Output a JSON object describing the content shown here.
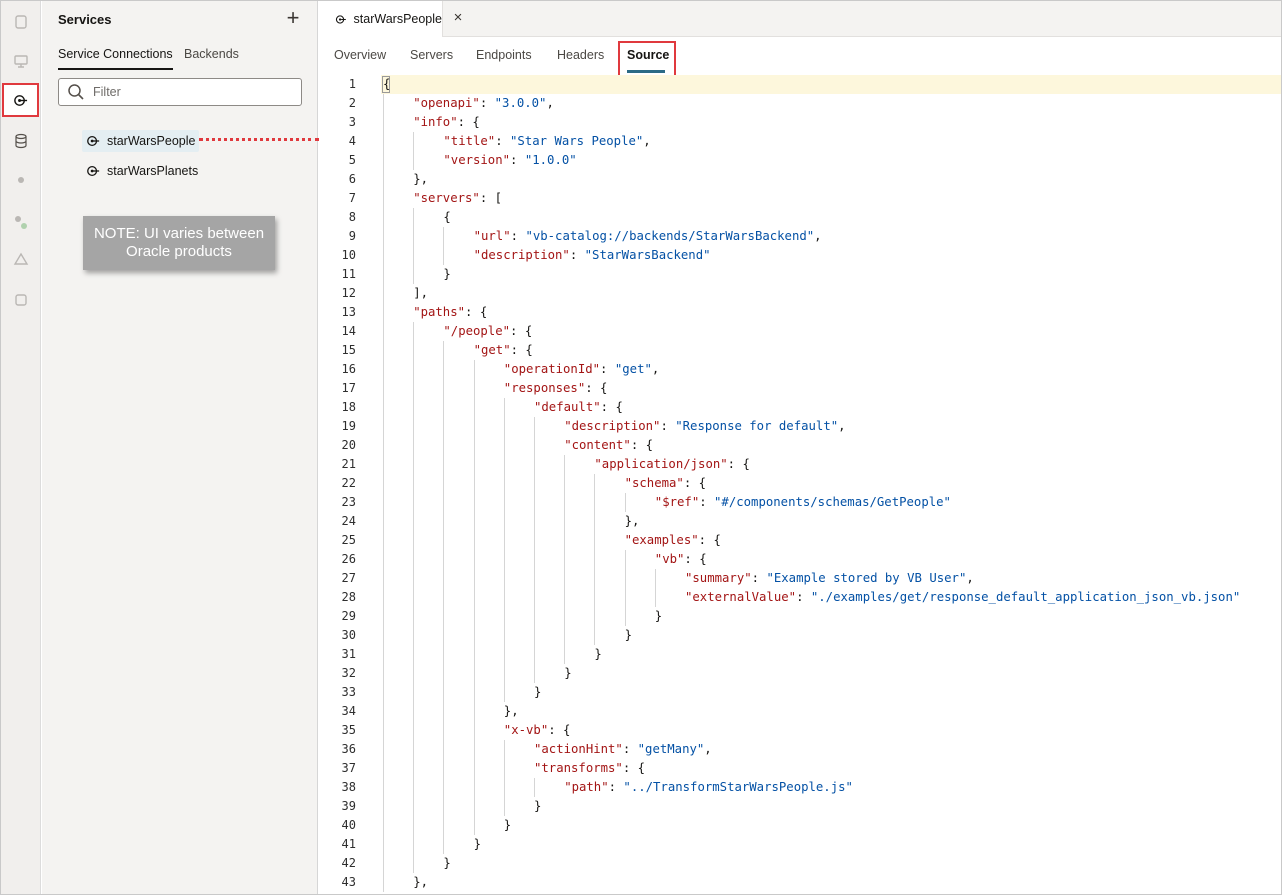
{
  "panel": {
    "title": "Services",
    "add_label": "+",
    "tabs": [
      "Service Connections",
      "Backends"
    ],
    "filter_placeholder": "Filter",
    "items": [
      "starWarsPeople",
      "starWarsPlanets"
    ]
  },
  "note": "NOTE: UI varies between Oracle products",
  "editor": {
    "tab_title": "starWarsPeople",
    "close_label": "×",
    "subtabs": [
      "Overview",
      "Servers",
      "Endpoints",
      "Headers",
      "Source"
    ],
    "active_subtab": "Source"
  },
  "colors": {
    "highlight": "#e0393e",
    "json_key": "#a31515",
    "json_string": "#0451a5",
    "active_underline": "#2b6a86"
  },
  "code_lines": [
    {
      "n": 1,
      "i": 0,
      "t": [
        [
          "p",
          "{"
        ]
      ]
    },
    {
      "n": 2,
      "i": 1,
      "t": [
        [
          "k",
          "\"openapi\""
        ],
        [
          "p",
          ": "
        ],
        [
          "s",
          "\"3.0.0\""
        ],
        [
          "p",
          ","
        ]
      ]
    },
    {
      "n": 3,
      "i": 1,
      "t": [
        [
          "k",
          "\"info\""
        ],
        [
          "p",
          ": {"
        ]
      ]
    },
    {
      "n": 4,
      "i": 2,
      "t": [
        [
          "k",
          "\"title\""
        ],
        [
          "p",
          ": "
        ],
        [
          "s",
          "\"Star Wars People\""
        ],
        [
          "p",
          ","
        ]
      ]
    },
    {
      "n": 5,
      "i": 2,
      "t": [
        [
          "k",
          "\"version\""
        ],
        [
          "p",
          ": "
        ],
        [
          "s",
          "\"1.0.0\""
        ]
      ]
    },
    {
      "n": 6,
      "i": 1,
      "t": [
        [
          "p",
          "},"
        ]
      ]
    },
    {
      "n": 7,
      "i": 1,
      "t": [
        [
          "k",
          "\"servers\""
        ],
        [
          "p",
          ": ["
        ]
      ]
    },
    {
      "n": 8,
      "i": 2,
      "t": [
        [
          "p",
          "{"
        ]
      ]
    },
    {
      "n": 9,
      "i": 3,
      "t": [
        [
          "k",
          "\"url\""
        ],
        [
          "p",
          ": "
        ],
        [
          "s",
          "\"vb-catalog://backends/StarWarsBackend\""
        ],
        [
          "p",
          ","
        ]
      ]
    },
    {
      "n": 10,
      "i": 3,
      "t": [
        [
          "k",
          "\"description\""
        ],
        [
          "p",
          ": "
        ],
        [
          "s",
          "\"StarWarsBackend\""
        ]
      ]
    },
    {
      "n": 11,
      "i": 2,
      "t": [
        [
          "p",
          "}"
        ]
      ]
    },
    {
      "n": 12,
      "i": 1,
      "t": [
        [
          "p",
          "],"
        ]
      ]
    },
    {
      "n": 13,
      "i": 1,
      "t": [
        [
          "k",
          "\"paths\""
        ],
        [
          "p",
          ": {"
        ]
      ]
    },
    {
      "n": 14,
      "i": 2,
      "t": [
        [
          "k",
          "\"/people\""
        ],
        [
          "p",
          ": {"
        ]
      ]
    },
    {
      "n": 15,
      "i": 3,
      "t": [
        [
          "k",
          "\"get\""
        ],
        [
          "p",
          ": {"
        ]
      ]
    },
    {
      "n": 16,
      "i": 4,
      "t": [
        [
          "k",
          "\"operationId\""
        ],
        [
          "p",
          ": "
        ],
        [
          "s",
          "\"get\""
        ],
        [
          "p",
          ","
        ]
      ]
    },
    {
      "n": 17,
      "i": 4,
      "t": [
        [
          "k",
          "\"responses\""
        ],
        [
          "p",
          ": {"
        ]
      ]
    },
    {
      "n": 18,
      "i": 5,
      "t": [
        [
          "k",
          "\"default\""
        ],
        [
          "p",
          ": {"
        ]
      ]
    },
    {
      "n": 19,
      "i": 6,
      "t": [
        [
          "k",
          "\"description\""
        ],
        [
          "p",
          ": "
        ],
        [
          "s",
          "\"Response for default\""
        ],
        [
          "p",
          ","
        ]
      ]
    },
    {
      "n": 20,
      "i": 6,
      "t": [
        [
          "k",
          "\"content\""
        ],
        [
          "p",
          ": {"
        ]
      ]
    },
    {
      "n": 21,
      "i": 7,
      "t": [
        [
          "k",
          "\"application/json\""
        ],
        [
          "p",
          ": {"
        ]
      ]
    },
    {
      "n": 22,
      "i": 8,
      "t": [
        [
          "k",
          "\"schema\""
        ],
        [
          "p",
          ": {"
        ]
      ]
    },
    {
      "n": 23,
      "i": 9,
      "t": [
        [
          "k",
          "\"$ref\""
        ],
        [
          "p",
          ": "
        ],
        [
          "s",
          "\"#/components/schemas/GetPeople\""
        ]
      ]
    },
    {
      "n": 24,
      "i": 8,
      "t": [
        [
          "p",
          "},"
        ]
      ]
    },
    {
      "n": 25,
      "i": 8,
      "t": [
        [
          "k",
          "\"examples\""
        ],
        [
          "p",
          ": {"
        ]
      ]
    },
    {
      "n": 26,
      "i": 9,
      "t": [
        [
          "k",
          "\"vb\""
        ],
        [
          "p",
          ": {"
        ]
      ]
    },
    {
      "n": 27,
      "i": 10,
      "t": [
        [
          "k",
          "\"summary\""
        ],
        [
          "p",
          ": "
        ],
        [
          "s",
          "\"Example stored by VB User\""
        ],
        [
          "p",
          ","
        ]
      ]
    },
    {
      "n": 28,
      "i": 10,
      "t": [
        [
          "k",
          "\"externalValue\""
        ],
        [
          "p",
          ": "
        ],
        [
          "s",
          "\"./examples/get/response_default_application_json_vb.json\""
        ]
      ]
    },
    {
      "n": 29,
      "i": 9,
      "t": [
        [
          "p",
          "}"
        ]
      ]
    },
    {
      "n": 30,
      "i": 8,
      "t": [
        [
          "p",
          "}"
        ]
      ]
    },
    {
      "n": 31,
      "i": 7,
      "t": [
        [
          "p",
          "}"
        ]
      ]
    },
    {
      "n": 32,
      "i": 6,
      "t": [
        [
          "p",
          "}"
        ]
      ]
    },
    {
      "n": 33,
      "i": 5,
      "t": [
        [
          "p",
          "}"
        ]
      ]
    },
    {
      "n": 34,
      "i": 4,
      "t": [
        [
          "p",
          "},"
        ]
      ]
    },
    {
      "n": 35,
      "i": 4,
      "t": [
        [
          "k",
          "\"x-vb\""
        ],
        [
          "p",
          ": {"
        ]
      ]
    },
    {
      "n": 36,
      "i": 5,
      "t": [
        [
          "k",
          "\"actionHint\""
        ],
        [
          "p",
          ": "
        ],
        [
          "s",
          "\"getMany\""
        ],
        [
          "p",
          ","
        ]
      ]
    },
    {
      "n": 37,
      "i": 5,
      "t": [
        [
          "k",
          "\"transforms\""
        ],
        [
          "p",
          ": {"
        ]
      ]
    },
    {
      "n": 38,
      "i": 6,
      "t": [
        [
          "k",
          "\"path\""
        ],
        [
          "p",
          ": "
        ],
        [
          "s",
          "\"../TransformStarWarsPeople.js\""
        ]
      ]
    },
    {
      "n": 39,
      "i": 5,
      "t": [
        [
          "p",
          "}"
        ]
      ]
    },
    {
      "n": 40,
      "i": 4,
      "t": [
        [
          "p",
          "}"
        ]
      ]
    },
    {
      "n": 41,
      "i": 3,
      "t": [
        [
          "p",
          "}"
        ]
      ]
    },
    {
      "n": 42,
      "i": 2,
      "t": [
        [
          "p",
          "}"
        ]
      ]
    },
    {
      "n": 43,
      "i": 1,
      "t": [
        [
          "p",
          "},"
        ]
      ]
    }
  ]
}
